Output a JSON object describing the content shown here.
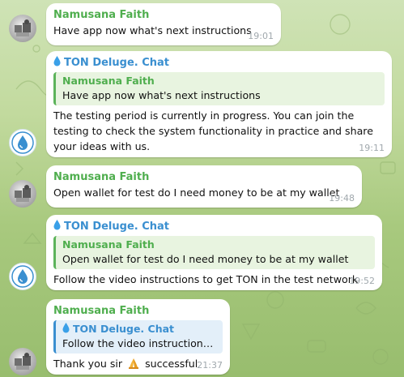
{
  "messages": [
    {
      "sender": "Namusana Faith",
      "text": "Have app now what's next instructions",
      "time": "19:01"
    },
    {
      "sender": "TON Deluge. Chat",
      "reply_to": {
        "sender": "Namusana Faith",
        "text": "Have app now what's next instructions"
      },
      "text": "The testing period is currently in progress. You can join the testing to check the system functionality in practice and share your ideas with us.",
      "time": "19:11"
    },
    {
      "sender": "Namusana Faith",
      "text": "Open wallet for test do I need money to be at my wallet",
      "time": "19:48"
    },
    {
      "sender": "TON Deluge. Chat",
      "reply_to": {
        "sender": "Namusana Faith",
        "text": "Open wallet for test do I need money to be at my wallet"
      },
      "text": "Follow the video instructions to get TON in the test network",
      "time": "19:52"
    },
    {
      "sender": "Namusana Faith",
      "reply_to": {
        "sender": "TON Deluge. Chat",
        "text": "Follow the video instructions t..."
      },
      "text_before": "Thank you sir",
      "text_after": "successful",
      "time": "21:37"
    }
  ],
  "icons": {
    "sender_badge": "water-drop-icon",
    "emoji": "folded-hands-icon"
  },
  "colors": {
    "user_name": "#4fae4e",
    "ton_name": "#3a8fd0",
    "background": "#b5d28c"
  }
}
